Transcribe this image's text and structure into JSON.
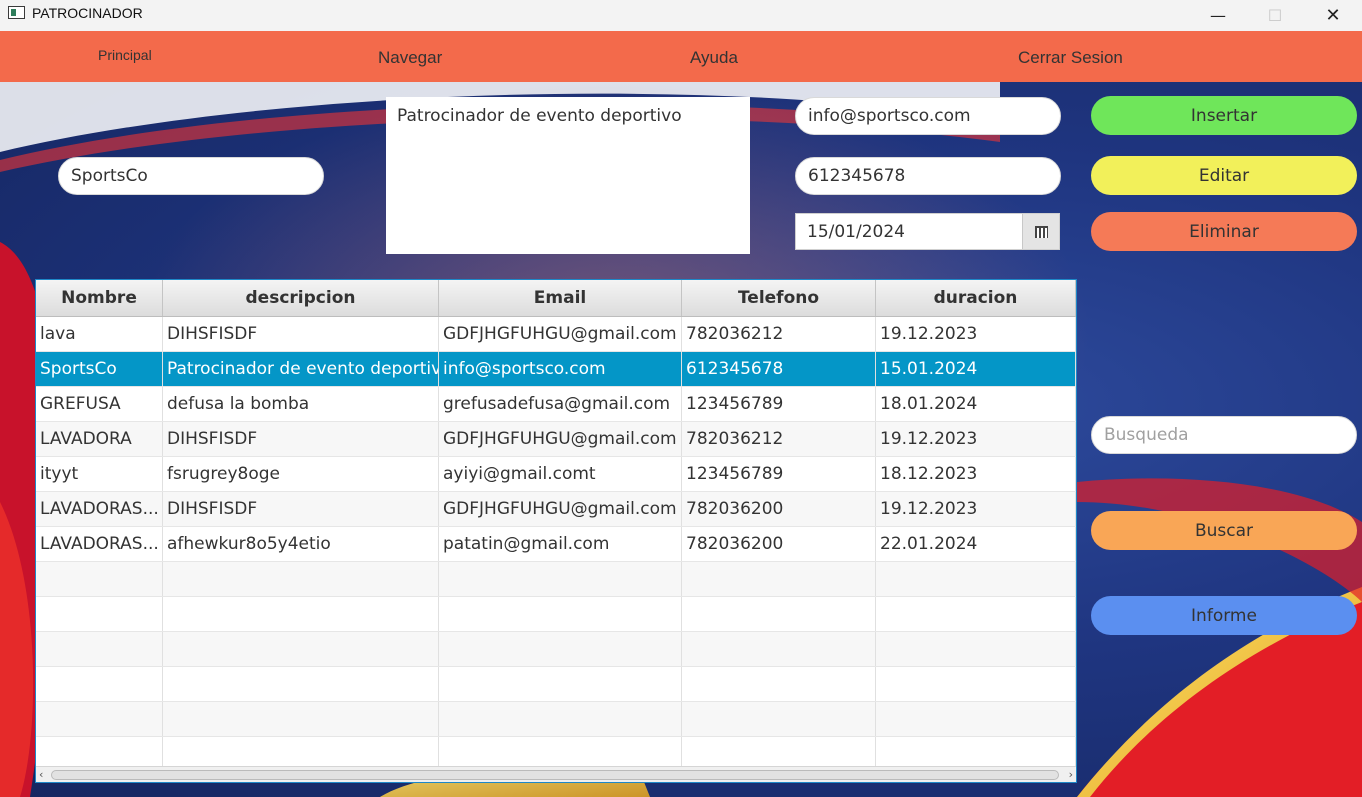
{
  "window": {
    "title": "PATROCINADOR",
    "controls": {
      "minimize": "—",
      "maximize": "☐",
      "close": "✕"
    }
  },
  "menu": {
    "items": [
      "Principal",
      "Navegar",
      "Ayuda",
      "Cerrar Sesion"
    ]
  },
  "form": {
    "nombre": "SportsCo",
    "descripcion": "Patrocinador de evento deportivo",
    "email": "info@sportsco.com",
    "telefono": "612345678",
    "fecha": "15/01/2024",
    "busqueda_placeholder": "Busqueda"
  },
  "buttons": {
    "insertar": "Insertar",
    "editar": "Editar",
    "eliminar": "Eliminar",
    "buscar": "Buscar",
    "informe": "Informe"
  },
  "button_colors": {
    "insertar": "#6fe65a",
    "editar": "#f2f05a",
    "eliminar": "#f57a57",
    "buscar": "#f9a656",
    "informe": "#5b8ff0"
  },
  "table": {
    "columns": [
      "Nombre",
      "descripcion",
      "Email",
      "Telefono",
      "duracion"
    ],
    "selected_index": 1,
    "rows": [
      [
        "lava",
        "DIHSFISDF",
        "GDFJHGFUHGU@gmail.com",
        "782036212",
        "19.12.2023"
      ],
      [
        "SportsCo",
        "Patrocinador de evento deportivo",
        "info@sportsco.com",
        "612345678",
        "15.01.2024"
      ],
      [
        "GREFUSA",
        "defusa la bomba",
        "grefusadefusa@gmail.com",
        "123456789",
        "18.01.2024"
      ],
      [
        "LAVADORA",
        "DIHSFISDF",
        "GDFJHGFUHGU@gmail.com",
        "782036212",
        "19.12.2023"
      ],
      [
        "ityyt",
        "fsrugrey8oge",
        "ayiyi@gmail.comt",
        "123456789",
        "18.12.2023"
      ],
      [
        "LAVADORAS...",
        "DIHSFISDF",
        "GDFJHGFUHGU@gmail.com",
        "782036200",
        "19.12.2023"
      ],
      [
        "LAVADORAS...",
        "afhewkur8o5y4etio",
        "patatin@gmail.com",
        "782036200",
        "22.01.2024"
      ]
    ],
    "empty_rows": 6
  },
  "icons": {
    "app": "app-window-icon",
    "calendar": "calendar-icon"
  },
  "theme": {
    "menubar": "#f36a4b",
    "selected_row": "#0496c7"
  }
}
